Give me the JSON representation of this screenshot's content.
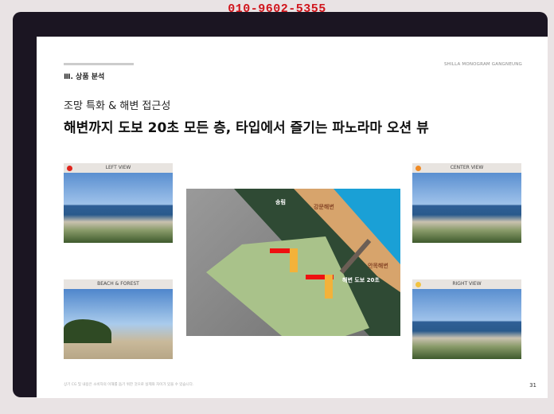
{
  "watermark_phone": "010-9602-5355",
  "header": {
    "section": "Ⅲ. 상품 분석",
    "brand": "SHILLA MONOGRAM GANGNEUNG"
  },
  "subtitle": "조망 특화 & 해변 접근성",
  "title": "해변까지 도보 20초 모든 층, 타입에서 즐기는 파노라마 오션 뷰",
  "views": [
    {
      "label": "LEFT VIEW",
      "dot": "#e0241c"
    },
    {
      "label": "BEACH & FOREST"
    },
    {
      "label": "CENTER VIEW",
      "dot": "#f08a24"
    },
    {
      "label": "RIGHT VIEW",
      "dot": "#f3c340"
    }
  ],
  "map": {
    "forest": "송림",
    "beach_north": "강문해변",
    "beach_south": "안목해변",
    "walk": "해변 도보 20초"
  },
  "footer": {
    "note": "상기 CG 및 내용은 소비자의 이해를 돕기 위한 것으로 실제와 차이가 있을 수 있습니다.",
    "page": "31"
  }
}
